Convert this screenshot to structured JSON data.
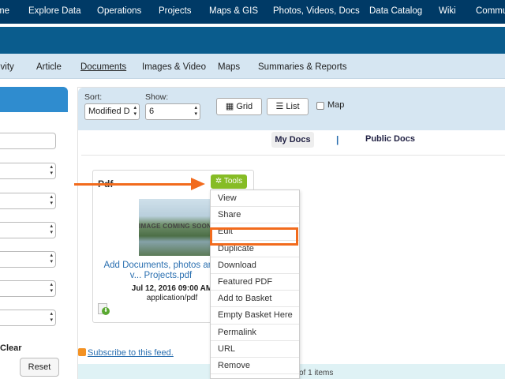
{
  "topnav": {
    "items": [
      "me",
      "Explore Data",
      "Operations",
      "Projects",
      "Maps & GIS",
      "Photos, Videos, Docs",
      "Data Catalog",
      "Wiki",
      "Commu"
    ]
  },
  "subnav": {
    "items": [
      "ivity",
      "Article",
      "Documents",
      "Images & Video",
      "Maps",
      "Summaries & Reports"
    ],
    "active": "Documents"
  },
  "leftpanel": {
    "clear_label": "Clear",
    "reset_label": "Reset"
  },
  "toolbar": {
    "sort_label": "Sort:",
    "sort_value": "Modified D",
    "show_label": "Show:",
    "show_value": "6",
    "grid_label": "Grid",
    "list_label": "List",
    "map_label": "Map"
  },
  "doctabs": {
    "my_docs": "My Docs",
    "separator": "|",
    "public_docs": "Public Docs"
  },
  "card": {
    "type": "Pdf",
    "thumb_text": "IMAGE COMING SOON",
    "title": "Add Documents, photos and v... Projects.pdf",
    "date": "Jul 12, 2016 09:00 AM",
    "mime": "application/pdf"
  },
  "tools": {
    "label": "Tools",
    "menu": [
      "View",
      "Share",
      "Edit",
      "Duplicate",
      "Download",
      "Featured PDF",
      "Add to Basket",
      "Empty Basket Here",
      "Permalink",
      "URL",
      "Remove"
    ],
    "highlighted": "Edit"
  },
  "footer": {
    "subscribe": "Subscribe to this feed.",
    "pager_text": "of 1 items"
  },
  "colors": {
    "topnav_bg": "#003a66",
    "banner_bg": "#0a5c8d",
    "tools_green": "#86bc25",
    "annotation_orange": "#f26b1d"
  }
}
